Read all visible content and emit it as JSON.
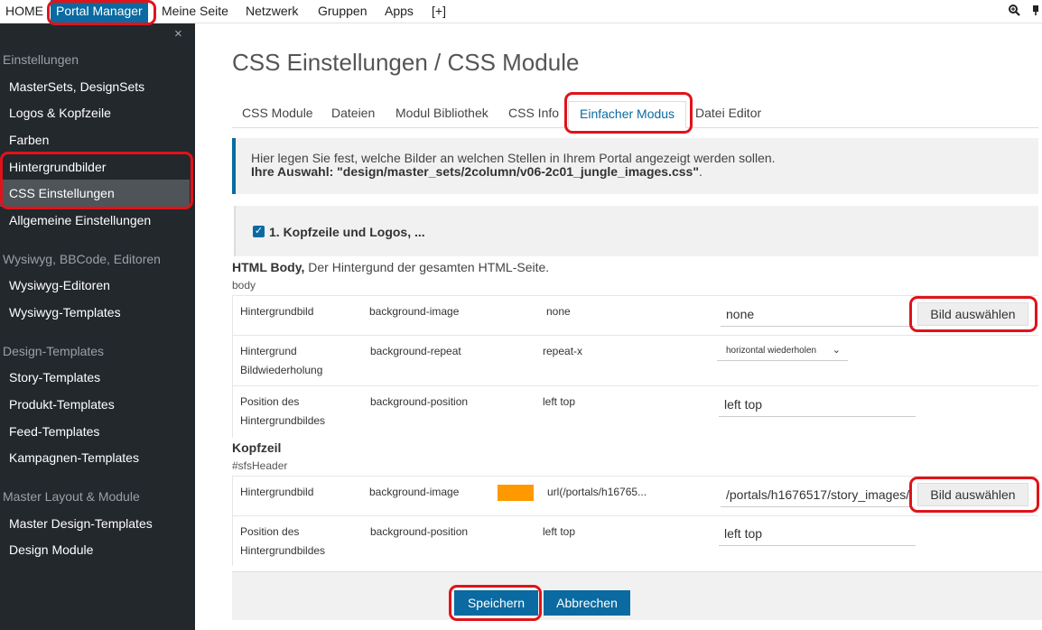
{
  "topnav": {
    "items": [
      "HOME",
      "Portal Manager",
      "Meine Seite",
      "Netzwerk",
      "Gruppen",
      "Apps",
      "[+]"
    ],
    "icons": [
      "zoom-icon",
      "pin-icon"
    ]
  },
  "sidebar": {
    "close": "×",
    "sections": [
      {
        "title": "Einstellungen",
        "items": [
          "MasterSets, DesignSets",
          "Logos & Kopfzeile",
          "Farben",
          "Hintergrundbilder",
          "CSS Einstellungen",
          "Allgemeine Einstellungen"
        ]
      },
      {
        "title": "Wysiwyg, BBCode, Editoren",
        "items": [
          "Wysiwyg-Editoren",
          "Wysiwyg-Templates"
        ]
      },
      {
        "title": "Design-Templates",
        "items": [
          "Story-Templates",
          "Produkt-Templates",
          "Feed-Templates",
          "Kampagnen-Templates"
        ]
      },
      {
        "title": "Master Layout & Module",
        "items": [
          "Master Design-Templates",
          "Design Module"
        ]
      }
    ],
    "active_item": "CSS Einstellungen"
  },
  "main": {
    "title": "CSS Einstellungen / CSS Module",
    "tabs": [
      "CSS Module",
      "Dateien",
      "Modul Bibliothek",
      "CSS Info",
      "Einfacher Modus",
      "Datei Editor"
    ],
    "active_tab": "Einfacher Modus",
    "info": {
      "line1": "Hier legen Sie fest, welche Bilder an welchen Stellen in Ihrem Portal angezeigt werden sollen.",
      "label": "Ihre Auswahl: \"design/master_sets/2column/v06-2c01_jungle_images.css\"",
      "end": "."
    },
    "section": {
      "checked": true,
      "check_glyph": "✓",
      "title": "1. Kopfzeile und Logos, ..."
    },
    "groups": [
      {
        "title": "HTML Body,",
        "desc": " Der Hintergund der gesamten HTML-Seite.",
        "selector": "body",
        "rows": [
          {
            "label": "Hintergrundbild",
            "property": "background-image",
            "value": "none",
            "input": "none",
            "button": "Bild auswählen"
          },
          {
            "label": "Hintergrund Bildwiederholung",
            "property": "background-repeat",
            "value": "repeat-x",
            "select": "horizontal wiederholen",
            "chevron": "⌄"
          },
          {
            "label": "Position des Hintergrundbildes",
            "property": "background-position",
            "value": "left top",
            "input": "left top"
          }
        ]
      },
      {
        "title": "Kopfzeil",
        "desc": "",
        "selector": "#sfsHeader",
        "rows": [
          {
            "label": "Hintergrundbild",
            "property": "background-image",
            "swatch": "#ff9900",
            "value": "url(/portals/h16765...",
            "input": "/portals/h1676517/story_images/",
            "button": "Bild auswählen"
          },
          {
            "label": "Position des Hintergrundbildes",
            "property": "background-position",
            "value": "left top",
            "input": "left top"
          }
        ]
      }
    ],
    "footer": {
      "save": "Speichern",
      "cancel": "Abbrechen"
    }
  },
  "colors": {
    "accent": "#0a6aa1",
    "sidebar": "#23282d",
    "annotation": "#e0131a"
  }
}
